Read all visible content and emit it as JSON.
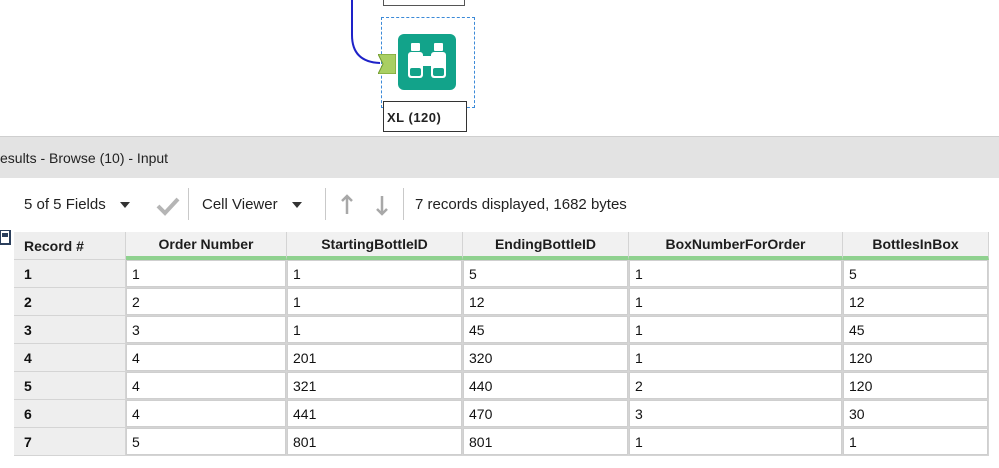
{
  "canvas": {
    "tool_label": "XL (120)",
    "tool_icon": "binoculars-icon",
    "accent_color": "#12a38a",
    "connector_color": "#1e22c8"
  },
  "results": {
    "title": "esults - Browse (10) - Input"
  },
  "toolbar": {
    "fields_label": "5 of 5 Fields",
    "cell_viewer_label": "Cell Viewer",
    "status_text": "7 records displayed, 1682 bytes"
  },
  "table": {
    "columns": [
      "Record #",
      "Order Number",
      "StartingBottleID",
      "EndingBottleID",
      "BoxNumberForOrder",
      "BottlesInBox"
    ],
    "rows": [
      [
        "1",
        "1",
        "1",
        "5",
        "1",
        "5"
      ],
      [
        "2",
        "2",
        "1",
        "12",
        "1",
        "12"
      ],
      [
        "3",
        "3",
        "1",
        "45",
        "1",
        "45"
      ],
      [
        "4",
        "4",
        "201",
        "320",
        "1",
        "120"
      ],
      [
        "5",
        "4",
        "321",
        "440",
        "2",
        "120"
      ],
      [
        "6",
        "4",
        "441",
        "470",
        "3",
        "30"
      ],
      [
        "7",
        "5",
        "801",
        "801",
        "1",
        "1"
      ]
    ]
  }
}
